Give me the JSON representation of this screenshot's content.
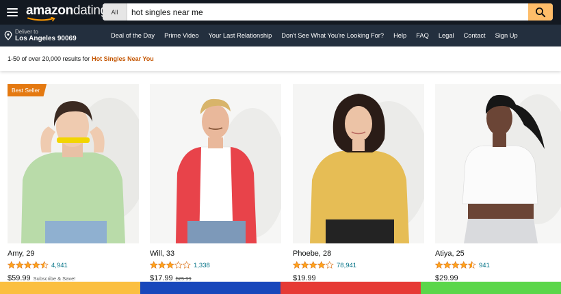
{
  "header": {
    "logo_brand": "amazon",
    "logo_sub": "dating",
    "search_category": "All",
    "search_value": "hot singles near me",
    "icons": {
      "menu": "hamburger-menu-icon",
      "search": "magnifier-icon",
      "location": "location-pin-icon"
    }
  },
  "nav": {
    "deliver_small": "Deliver to",
    "deliver_location": "Los Angeles 90069",
    "links": [
      "Deal of the Day",
      "Prime Video",
      "Your Last Relationship",
      "Don't See What You're Looking For?",
      "Help",
      "FAQ",
      "Legal",
      "Contact",
      "Sign Up"
    ]
  },
  "results": {
    "prefix": "1-50 of over 20,000 results for",
    "query": "Hot Singles Near You"
  },
  "products": [
    {
      "name": "Amy, 29",
      "rating": 4.5,
      "count": "4,941",
      "price": "$59.99",
      "old_price": "",
      "promo": "Subscribe & Save!",
      "badge": "Best Seller"
    },
    {
      "name": "Will, 33",
      "rating": 3,
      "count": "1,338",
      "price": "$17.99",
      "old_price": "$25.99",
      "promo": "",
      "badge": ""
    },
    {
      "name": "Phoebe, 28",
      "rating": 4,
      "count": "78,941",
      "price": "$19.99",
      "old_price": "",
      "promo": "",
      "badge": ""
    },
    {
      "name": "Atiya, 25",
      "rating": 4.5,
      "count": "941",
      "price": "$29.99",
      "old_price": "",
      "promo": "",
      "badge": ""
    }
  ],
  "colors": {
    "header_bg": "#131921",
    "nav_bg": "#232f3e",
    "search_button": "#febd69",
    "query_highlight": "#c45500",
    "link": "#007185",
    "star": "#ffa41c",
    "badge": "#e47911",
    "bottom_stripes": [
      "#fbbf40",
      "#1847bb",
      "#e63a35",
      "#5bd64a"
    ]
  }
}
